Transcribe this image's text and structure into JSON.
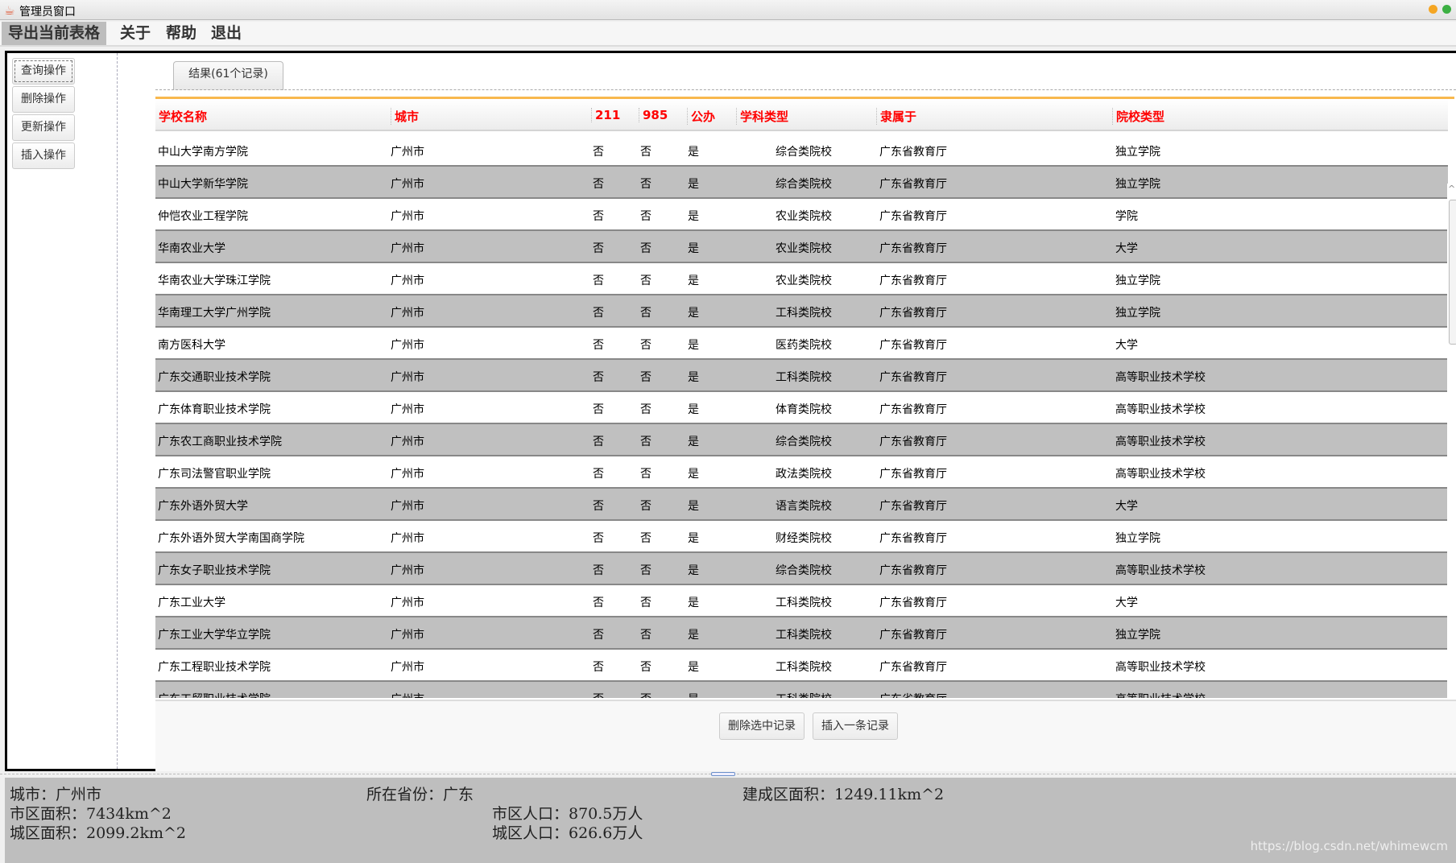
{
  "window": {
    "title": "管理员窗口"
  },
  "menu": [
    "导出当前表格",
    "关于",
    "帮助",
    "退出"
  ],
  "sidebar": {
    "buttons": [
      "查询操作",
      "删除操作",
      "更新操作",
      "插入操作"
    ]
  },
  "tab": {
    "label": "结果(61个记录)"
  },
  "table": {
    "columns": [
      "学校名称",
      "城市",
      "211",
      "985",
      "公办",
      "学科类型",
      "隶属于",
      "院校类型"
    ],
    "rows": [
      [
        "中山大学南方学院",
        "广州市",
        "否",
        "否",
        "是",
        "综合类院校",
        "广东省教育厅",
        "独立学院"
      ],
      [
        "中山大学新华学院",
        "广州市",
        "否",
        "否",
        "是",
        "综合类院校",
        "广东省教育厅",
        "独立学院"
      ],
      [
        "仲恺农业工程学院",
        "广州市",
        "否",
        "否",
        "是",
        "农业类院校",
        "广东省教育厅",
        "学院"
      ],
      [
        "华南农业大学",
        "广州市",
        "否",
        "否",
        "是",
        "农业类院校",
        "广东省教育厅",
        "大学"
      ],
      [
        "华南农业大学珠江学院",
        "广州市",
        "否",
        "否",
        "是",
        "农业类院校",
        "广东省教育厅",
        "独立学院"
      ],
      [
        "华南理工大学广州学院",
        "广州市",
        "否",
        "否",
        "是",
        "工科类院校",
        "广东省教育厅",
        "独立学院"
      ],
      [
        "南方医科大学",
        "广州市",
        "否",
        "否",
        "是",
        "医药类院校",
        "广东省教育厅",
        "大学"
      ],
      [
        "广东交通职业技术学院",
        "广州市",
        "否",
        "否",
        "是",
        "工科类院校",
        "广东省教育厅",
        "高等职业技术学校"
      ],
      [
        "广东体育职业技术学院",
        "广州市",
        "否",
        "否",
        "是",
        "体育类院校",
        "广东省教育厅",
        "高等职业技术学校"
      ],
      [
        "广东农工商职业技术学院",
        "广州市",
        "否",
        "否",
        "是",
        "综合类院校",
        "广东省教育厅",
        "高等职业技术学校"
      ],
      [
        "广东司法警官职业学院",
        "广州市",
        "否",
        "否",
        "是",
        "政法类院校",
        "广东省教育厅",
        "高等职业技术学校"
      ],
      [
        "广东外语外贸大学",
        "广州市",
        "否",
        "否",
        "是",
        "语言类院校",
        "广东省教育厅",
        "大学"
      ],
      [
        "广东外语外贸大学南国商学院",
        "广州市",
        "否",
        "否",
        "是",
        "财经类院校",
        "广东省教育厅",
        "独立学院"
      ],
      [
        "广东女子职业技术学院",
        "广州市",
        "否",
        "否",
        "是",
        "综合类院校",
        "广东省教育厅",
        "高等职业技术学校"
      ],
      [
        "广东工业大学",
        "广州市",
        "否",
        "否",
        "是",
        "工科类院校",
        "广东省教育厅",
        "大学"
      ],
      [
        "广东工业大学华立学院",
        "广州市",
        "否",
        "否",
        "是",
        "工科类院校",
        "广东省教育厅",
        "独立学院"
      ],
      [
        "广东工程职业技术学院",
        "广州市",
        "否",
        "否",
        "是",
        "工科类院校",
        "广东省教育厅",
        "高等职业技术学校"
      ],
      [
        "广东工贸职业技术学院",
        "广州市",
        "否",
        "否",
        "是",
        "工科类院校",
        "广东省教育厅",
        "高等职业技术学校"
      ]
    ]
  },
  "actions": {
    "delete": "删除选中记录",
    "insert": "插入一条记录"
  },
  "info": {
    "city": "城市：广州市",
    "province": "所在省份：广东",
    "built_area": "建成区面积：1249.11km^2",
    "urban_area": "市区面积：7434km^2",
    "urban_pop": "市区人口：870.5万人",
    "city_area": "城区面积：2099.2km^2",
    "city_pop": "城区人口：626.6万人"
  },
  "watermark": "https://blog.csdn.net/whimewcm",
  "colors": {
    "header_text": "#ff0000",
    "alt_row": "#c0c0c0",
    "tab_accent": "#f8b84e",
    "info_bg": "#bebebe"
  }
}
